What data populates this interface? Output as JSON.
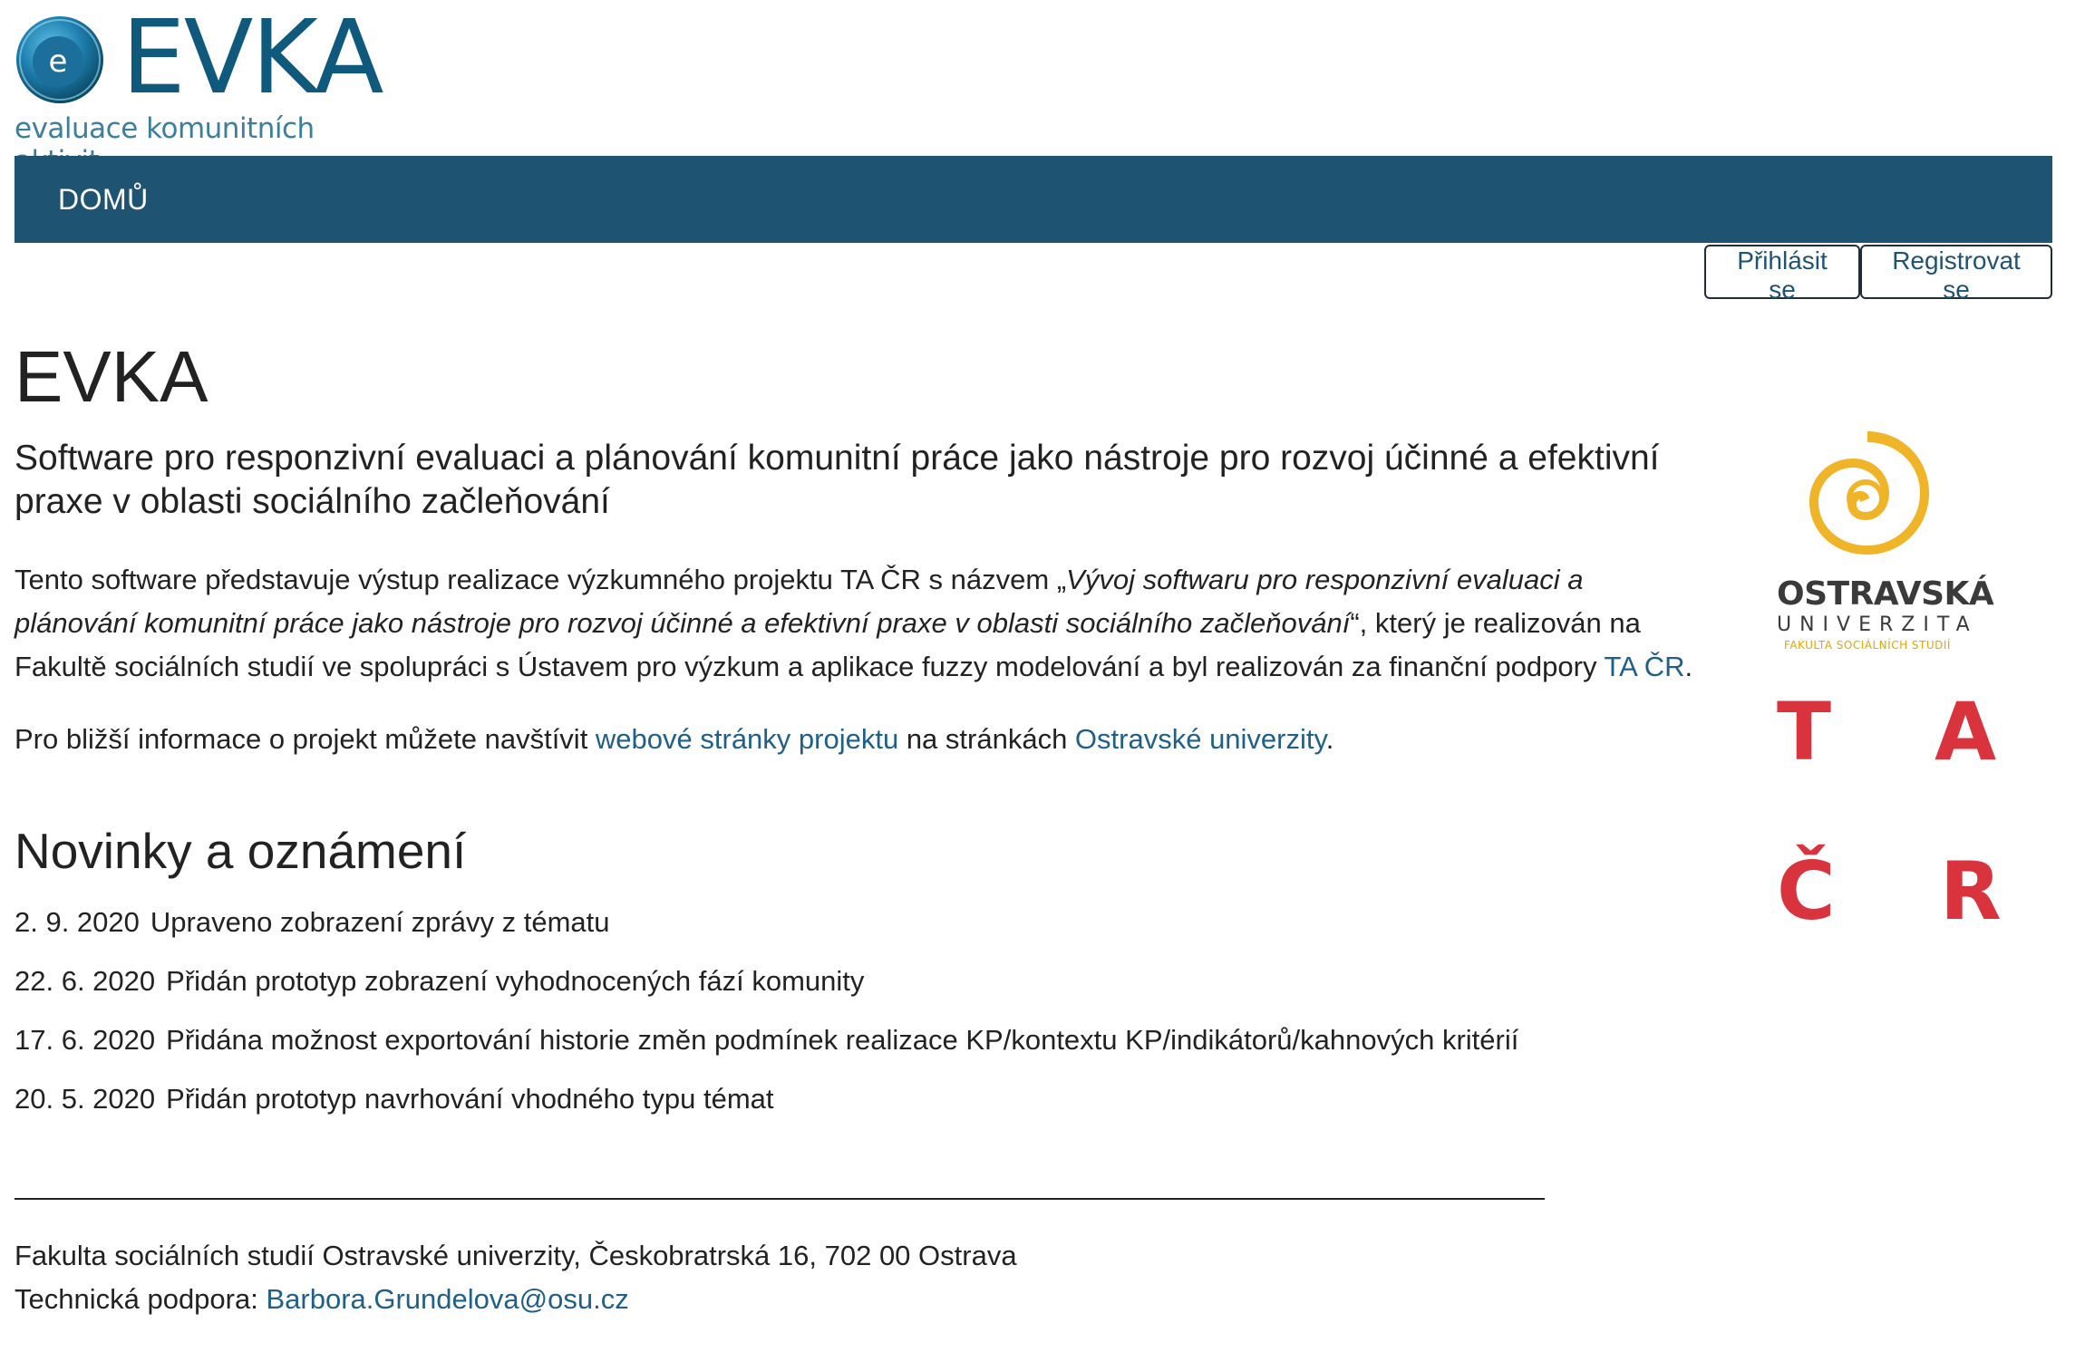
{
  "logo": {
    "icon_letter": "e",
    "title": "EVKA",
    "subtitle": "evaluace komunitních aktivit"
  },
  "nav": {
    "home": "DOMŮ"
  },
  "auth": {
    "login": "Přihlásit se",
    "register": "Registrovat se"
  },
  "page": {
    "title": "EVKA",
    "subtitle": "Software pro responzivní evaluaci a plánování komunitní práce jako nástroje pro rozvoj účinné a efektivní praxe v oblasti sociálního začleňování",
    "intro": {
      "part1": "Tento software představuje výstup realizace výzkumného projektu TA ČR s názvem „",
      "italic": "Vývoj softwaru pro responzivní evaluaci a plánování komunitní práce jako nástroje pro rozvoj účinné a efektivní praxe v oblasti sociálního začleňování",
      "part2": "“, který je realizován na Fakultě sociálních studií ve spolupráci s Ústavem pro výzkum a aplikace fuzzy modelování a byl realizován za finanční podpory ",
      "link": "TA ČR",
      "part3": "."
    },
    "more_info": {
      "part1": "Pro bližší informace o projekt můžete navštívit ",
      "link1": "webové stránky projektu",
      "part2": " na stránkách ",
      "link2": "Ostravské univerzity",
      "part3": "."
    }
  },
  "news": {
    "heading": "Novinky a oznámení",
    "items": [
      {
        "date": "2. 9. 2020",
        "text": "Upraveno zobrazení zprávy z tématu"
      },
      {
        "date": "22. 6. 2020",
        "text": "Přidán prototyp zobrazení vyhodnocených fází komunity"
      },
      {
        "date": "17. 6. 2020",
        "text": "Přidána možnost exportování historie změn podmínek realizace KP/kontextu KP/indikátorů/kahnových kritérií"
      },
      {
        "date": "20. 5. 2020",
        "text": "Přidán prototyp navrhování vhodného typu témat"
      }
    ]
  },
  "footer": {
    "address": "Fakulta sociálních studií Ostravské univerzity, Českobratrská 16, 702 00 Ostrava",
    "support_label": "Technická podpora: ",
    "support_email": "Barbora.Grundelova@osu.cz"
  },
  "partner_logos": {
    "ou": {
      "name": "OSTRAVSKÁ",
      "sub": "UNIVERZITA",
      "faculty": "FAKULTA SOCIÁLNÍCH STUDIÍ"
    },
    "tacr": {
      "letters": [
        "T",
        "A",
        "Č",
        "R"
      ]
    }
  },
  "colors": {
    "brand": "#0f5a7c",
    "nav_bg": "#1f5372",
    "link": "#1f5f88",
    "tacr_red": "#d9343d",
    "ou_gold": "#f0b429"
  }
}
